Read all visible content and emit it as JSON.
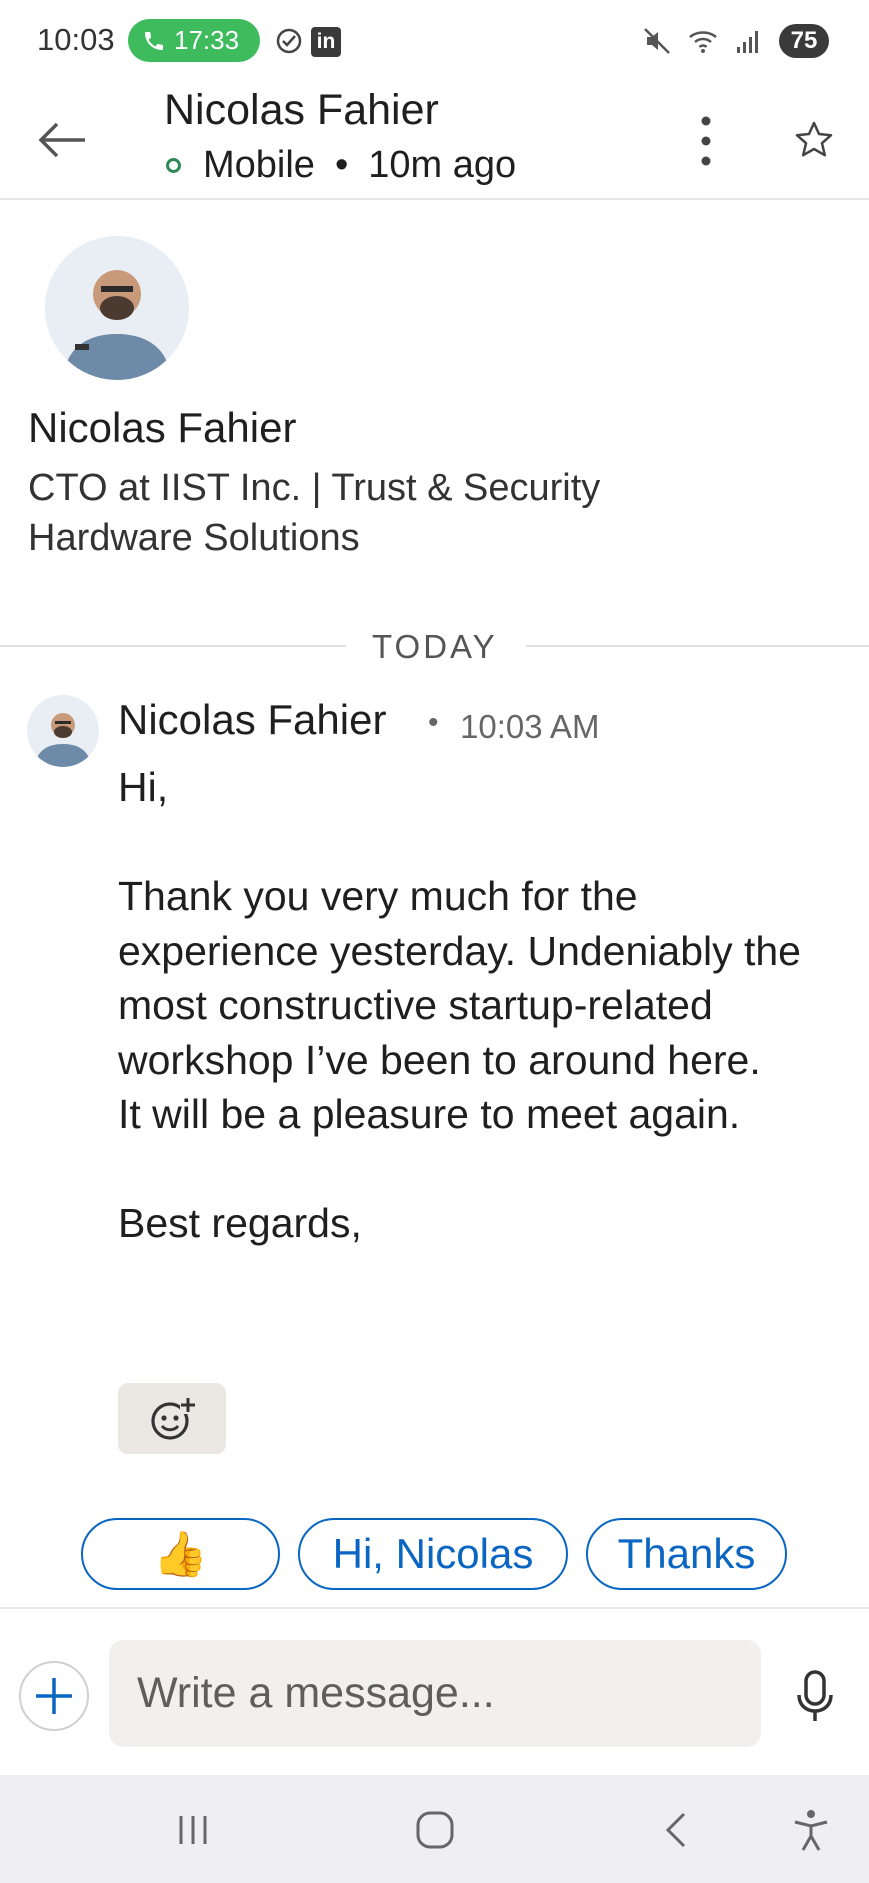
{
  "status_bar": {
    "time": "10:03",
    "call_duration": "17:33",
    "linkedin_badge": "in",
    "battery": "75"
  },
  "header": {
    "contact_name": "Nicolas Fahier",
    "device": "Mobile",
    "last_seen": "10m ago",
    "icons": [
      "arrow-left-icon",
      "more-vertical-icon",
      "star-icon"
    ]
  },
  "profile": {
    "name": "Nicolas Fahier",
    "headline": "CTO at IIST Inc. | Trust & Security Hardware Solutions"
  },
  "divider": {
    "label": "TODAY"
  },
  "message": {
    "author": "Nicolas Fahier",
    "time": "10:03 AM",
    "line_greeting": "Hi,",
    "line_body": "Thank you very much for the experience yesterday. Undeniably the most constructive startup-related workshop I’ve been to around here.",
    "line_meet": "It will be a pleasure to meet again.",
    "line_signoff": "Best regards,"
  },
  "quick_replies": [
    "👍",
    "Hi, Nicolas",
    "Thanks"
  ],
  "composer": {
    "placeholder": "Write a message..."
  },
  "colors": {
    "accent": "#0a66c2",
    "call_green": "#3dbb5d",
    "online_green": "#2e8a57"
  }
}
